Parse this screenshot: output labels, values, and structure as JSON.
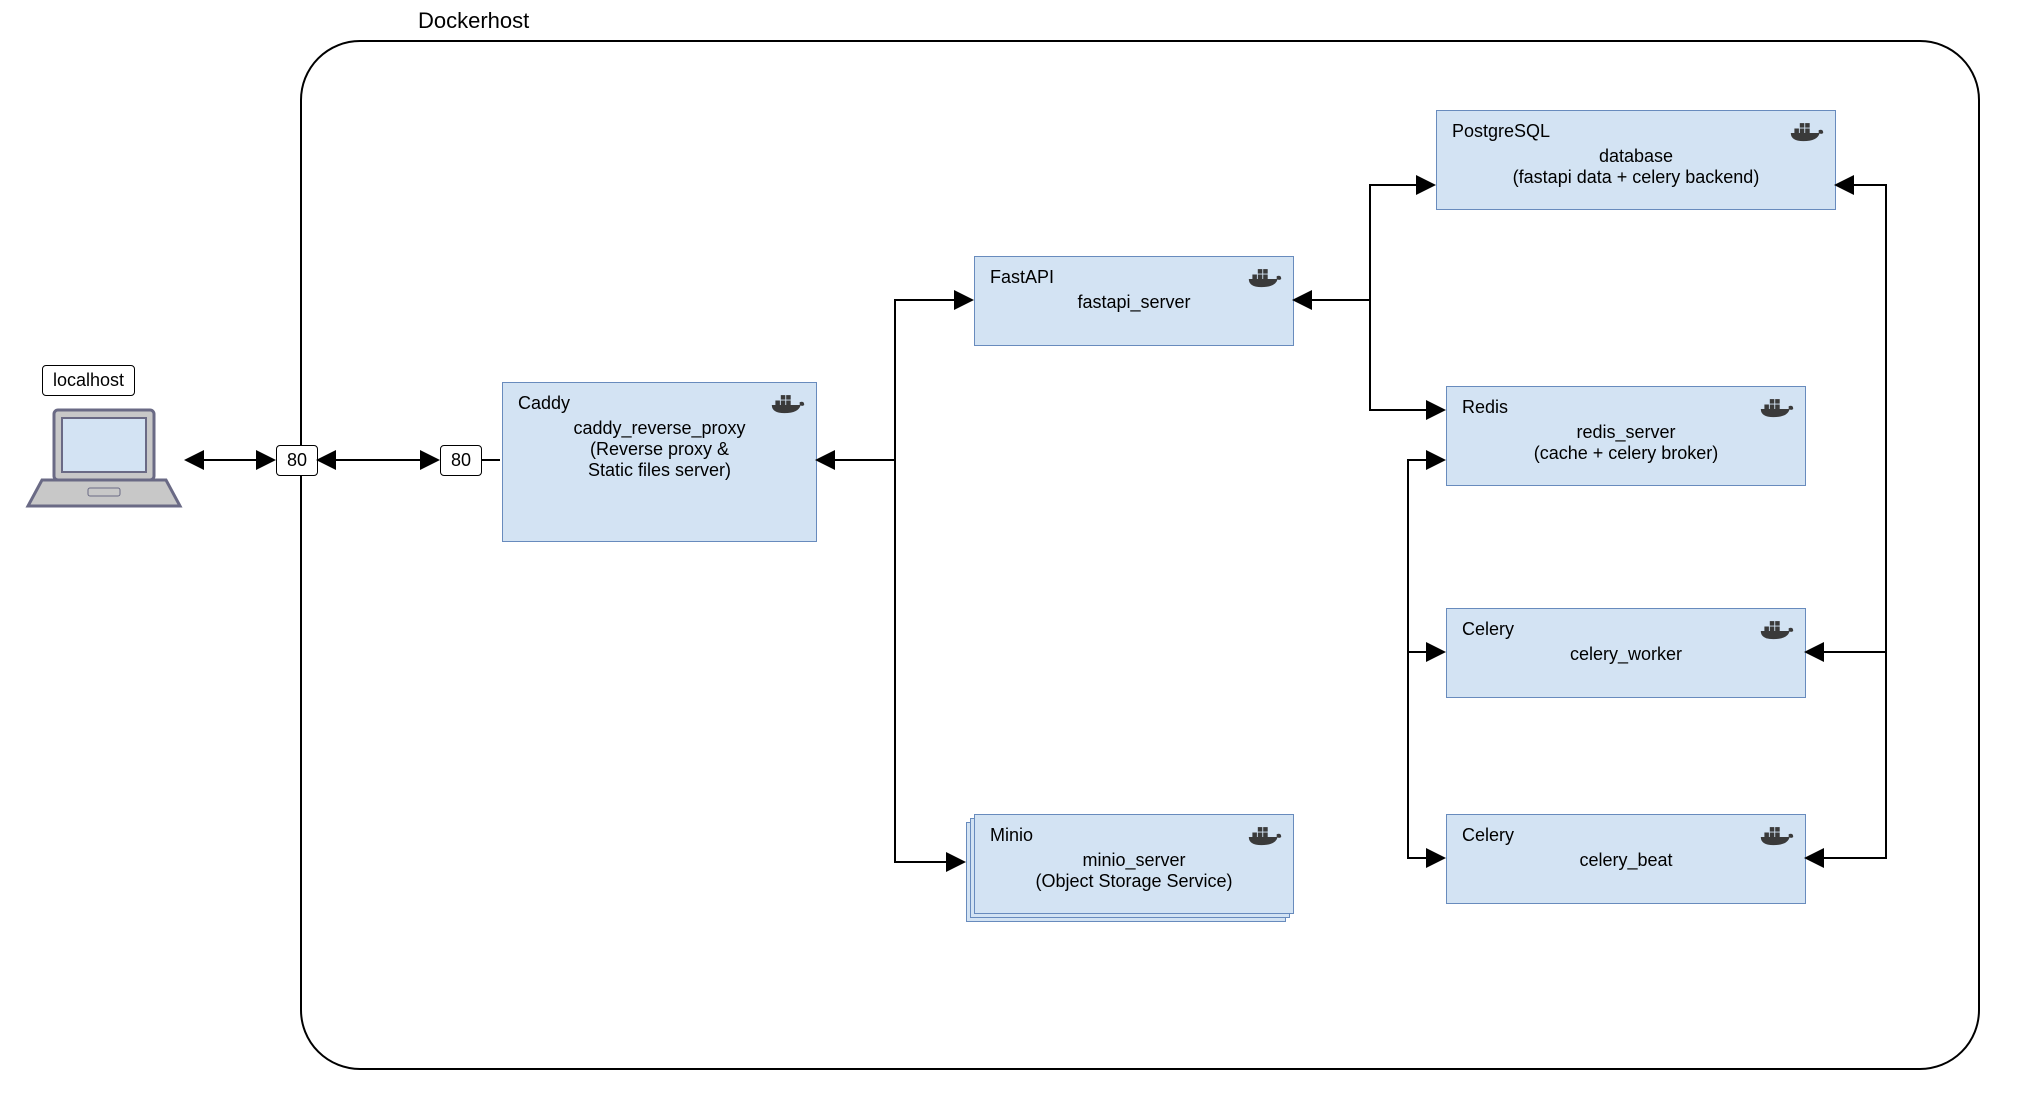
{
  "colors": {
    "node_fill": "#d3e3f3",
    "node_stroke": "#688bbd",
    "wire": "#000000"
  },
  "dockerhost": {
    "label": "Dockerhost"
  },
  "localhost": {
    "label": "localhost"
  },
  "ports": {
    "left": "80",
    "right": "80"
  },
  "caddy": {
    "title": "Caddy",
    "line1": "caddy_reverse_proxy",
    "line2": "(Reverse proxy &",
    "line3": "Static files server)"
  },
  "fastapi": {
    "title": "FastAPI",
    "line1": "fastapi_server"
  },
  "minio": {
    "title": "Minio",
    "line1": "minio_server",
    "line2": "(Object Storage Service)"
  },
  "postgres": {
    "title": "PostgreSQL",
    "line1": "database",
    "line2": "(fastapi data + celery backend)"
  },
  "redis": {
    "title": "Redis",
    "line1": "redis_server",
    "line2": "(cache + celery broker)"
  },
  "celery_worker": {
    "title": "Celery",
    "line1": "celery_worker"
  },
  "celery_beat": {
    "title": "Celery",
    "line1": "celery_beat"
  },
  "icons": {
    "docker": "docker-icon",
    "laptop": "laptop-icon"
  }
}
